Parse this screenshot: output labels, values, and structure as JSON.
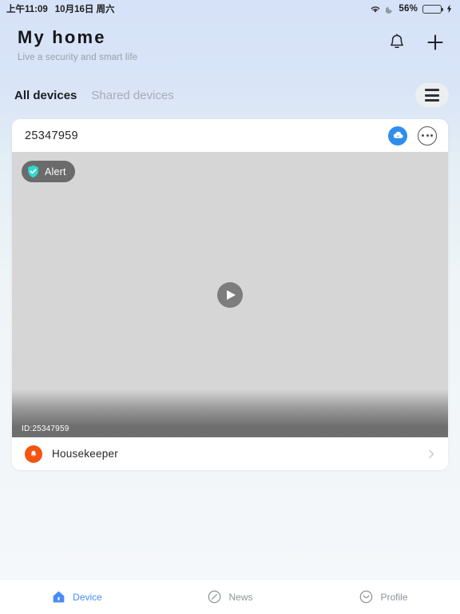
{
  "status_bar": {
    "time": "上午11:09",
    "date": "10月16日 周六",
    "battery_percent": "56%",
    "battery_level": 56,
    "icons": [
      "wifi-icon",
      "moon-icon",
      "battery-icon",
      "charging-bolt-icon"
    ]
  },
  "header": {
    "title": "My home",
    "subtitle": "Live a security and smart life",
    "notification_icon": "bell-icon",
    "add_icon": "plus-icon"
  },
  "tabs": {
    "items": [
      {
        "label": "All devices",
        "active": true
      },
      {
        "label": "Shared devices",
        "active": false
      }
    ],
    "menu_icon": "hamburger-menu-icon"
  },
  "device_card": {
    "name": "25347959",
    "cloud_icon": "cloud-icon",
    "more_icon": "more-options-icon",
    "alert_badge": {
      "label": "Alert",
      "icon": "shield-check-icon"
    },
    "play_icon": "play-icon",
    "video_id": "ID:25347959",
    "housekeeper": {
      "label": "Housekeeper",
      "icon": "bell-icon",
      "chevron_icon": "chevron-right-icon"
    }
  },
  "bottom_nav": {
    "items": [
      {
        "label": "Device",
        "icon": "home-icon",
        "active": true
      },
      {
        "label": "News",
        "icon": "compass-icon",
        "active": false
      },
      {
        "label": "Profile",
        "icon": "smiley-icon",
        "active": false
      }
    ]
  },
  "colors": {
    "accent_blue": "#4a8cf7",
    "cloud_blue": "#2f8ded",
    "alert_teal": "#2fd9d2",
    "housekeeper_orange": "#f4540f",
    "battery_green": "#3cd24a"
  }
}
